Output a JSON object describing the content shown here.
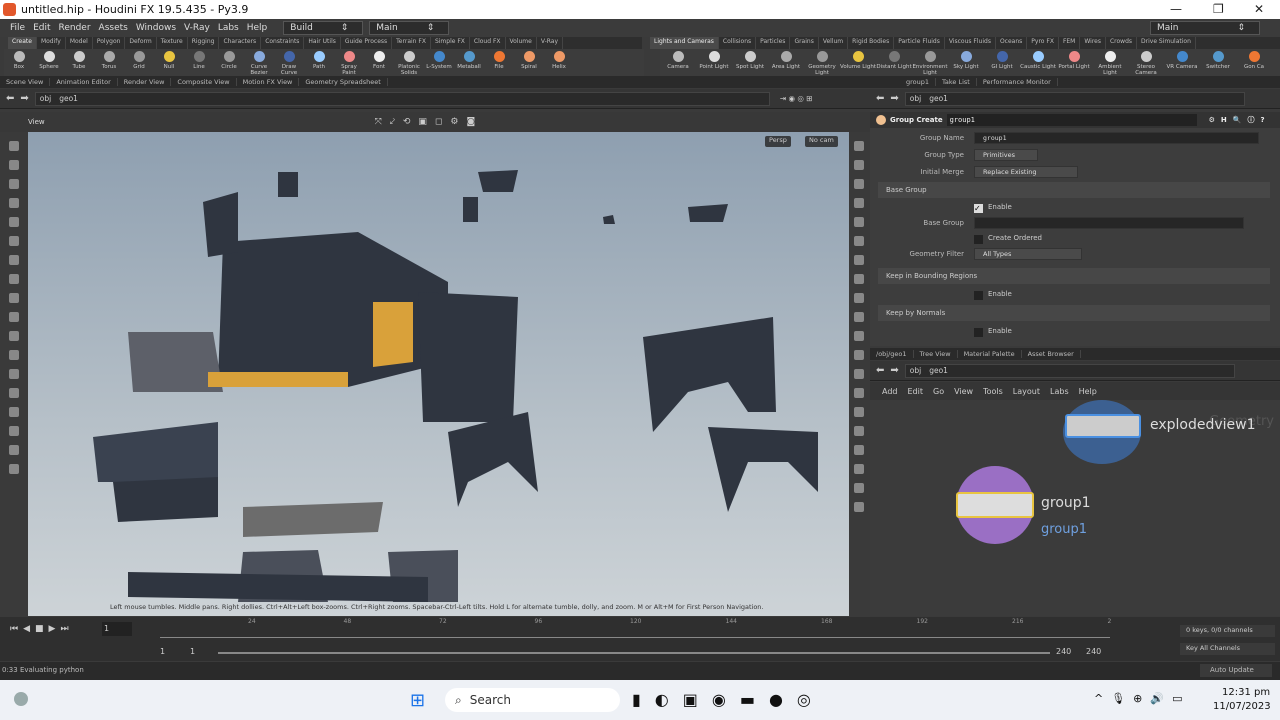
{
  "window": {
    "title": "untitled.hip - Houdini FX 19.5.435 - Py3.9"
  },
  "menu": [
    "File",
    "Edit",
    "Render",
    "Assets",
    "Windows",
    "V-Ray",
    "Labs",
    "Help"
  ],
  "desktop": "Build",
  "main_left": "Main",
  "main_right": "Main",
  "shelf_tabs_left": [
    "Create",
    "Modify",
    "Model",
    "Polygon",
    "Deform",
    "Texture",
    "Rigging",
    "Characters",
    "Constraints",
    "Hair Utils",
    "Guide Process",
    "Terrain FX",
    "Simple FX",
    "Cloud FX",
    "Volume",
    "V-Ray"
  ],
  "shelf_tools_left": [
    "Box",
    "Sphere",
    "Tube",
    "Torus",
    "Grid",
    "Null",
    "Line",
    "Circle",
    "Curve Bezier",
    "Draw Curve",
    "Path",
    "Spray Paint",
    "Font",
    "Platonic Solids",
    "L-System",
    "Metaball",
    "File",
    "Spiral",
    "Helix"
  ],
  "shelf_tabs_right": [
    "Lights and Cameras",
    "Collisions",
    "Particles",
    "Grains",
    "Vellum",
    "Rigid Bodies",
    "Particle Fluids",
    "Viscous Fluids",
    "Oceans",
    "Pyro FX",
    "FEM",
    "Wires",
    "Crowds",
    "Drive Simulation"
  ],
  "shelf_tools_right": [
    "Camera",
    "Point Light",
    "Spot Light",
    "Area Light",
    "Geometry Light",
    "Volume Light",
    "Distant Light",
    "Environment Light",
    "Sky Light",
    "GI Light",
    "Caustic Light",
    "Portal Light",
    "Ambient Light",
    "Stereo Camera",
    "VR Camera",
    "Switcher",
    "Gon Ca"
  ],
  "pane_tabs_left": [
    "Scene View",
    "Animation Editor",
    "Render View",
    "Composite View",
    "Motion FX View",
    "Geometry Spreadsheet"
  ],
  "pane_tabs_right": [
    "group1",
    "Take List",
    "Performance Monitor"
  ],
  "path": {
    "root": "obj",
    "node": "geo1"
  },
  "viewport": {
    "label": "View",
    "persp": "Persp",
    "cam": "No cam",
    "hint": "Left mouse tumbles. Middle pans. Right dollies. Ctrl+Alt+Left box-zooms. Ctrl+Right zooms. Spacebar-Ctrl-Left tilts. Hold L for alternate tumble, dolly, and zoom.    M or Alt+M for First Person Navigation."
  },
  "params": {
    "node_type": "Group Create",
    "node_name": "group1",
    "group_name_label": "Group Name",
    "group_name": "group1",
    "group_type_label": "Group Type",
    "group_type": "Primitives",
    "initial_merge_label": "Initial Merge",
    "initial_merge": "Replace Existing",
    "base_group_section": "Base Group",
    "enable": "Enable",
    "base_group_label": "Base Group",
    "create_ordered": "Create Ordered",
    "geometry_filter_label": "Geometry Filter",
    "geometry_filter": "All Types",
    "bounding_section": "Keep in Bounding Regions",
    "normals_section": "Keep by Normals"
  },
  "network_tabs": [
    "/obj/geo1",
    "Tree View",
    "Material Palette",
    "Asset Browser"
  ],
  "network_menu": [
    "Add",
    "Edit",
    "Go",
    "View",
    "Tools",
    "Layout",
    "Labs",
    "Help"
  ],
  "network": {
    "context": "Geometry",
    "node1": "explodedview1",
    "node2": "group1",
    "node2_sub": "group1"
  },
  "timeline": {
    "frame": "1",
    "ticks": [
      "24",
      "48",
      "72",
      "96",
      "120",
      "144",
      "168",
      "192",
      "216",
      "2"
    ],
    "start": "1",
    "start2": "1",
    "end": "240",
    "end2": "240",
    "keys": "0 keys, 0/0 channels",
    "key_all": "Key All Channels"
  },
  "status": {
    "text": "0:33 Evaluating python",
    "update": "Auto Update"
  },
  "taskbar": {
    "search": "Search",
    "time": "12:31 pm",
    "date": "11/07/2023"
  }
}
